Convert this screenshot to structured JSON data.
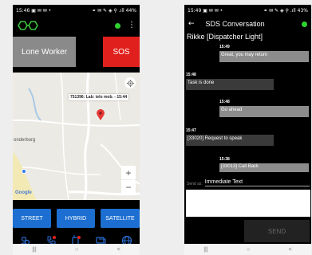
{
  "phone1": {
    "status": {
      "time": "15:46",
      "left_icons": "▣ ✉ ✉ •",
      "right_icons": "⚭ ✉ ✎ ◈ ⚲ .ıll",
      "battery": "44%"
    },
    "lone_worker_label": "Lone Worker",
    "sos_label": "SOS",
    "map": {
      "tooltip": "751396: Lab: telo mob. - 15:44",
      "town": "onderborg",
      "google": "Google"
    },
    "map_types": [
      "STREET",
      "HYBRID",
      "SATELLITE"
    ],
    "zoom_in": "+",
    "zoom_out": "−",
    "nav": [
      "|||",
      "○",
      "<"
    ],
    "colors": {
      "accent_blue": "#1c6fd1",
      "sos_red": "#e0201c",
      "online_green": "#2fd22f",
      "logo_green": "#3ec43e"
    }
  },
  "phone2": {
    "status": {
      "time": "15:49",
      "left_icons": "▣ ✉ ✉ •",
      "right_icons": "⚭ ✉ ✎ ◈ ⚲ .ıll",
      "battery": "43%"
    },
    "title": "SDS Conversation",
    "back": "←",
    "contact": "Rikke [Dispatcher Light]",
    "messages": [
      {
        "time": "15:49",
        "text": "Great, you may return",
        "side": "right"
      },
      {
        "time": "15:48",
        "text": "Task is done",
        "side": "left"
      },
      {
        "time": "15:48",
        "text": "Go ahead",
        "side": "right"
      },
      {
        "time": "15:47",
        "text": "[33020] Request to speak",
        "side": "left"
      },
      {
        "time": "15:38",
        "text": "[33013] Call Back",
        "side": "right"
      }
    ],
    "send_as_label": "Send as:",
    "send_as_value": "Immediate Text",
    "send_label": "SEND",
    "nav": [
      "|||",
      "○",
      "<"
    ]
  }
}
